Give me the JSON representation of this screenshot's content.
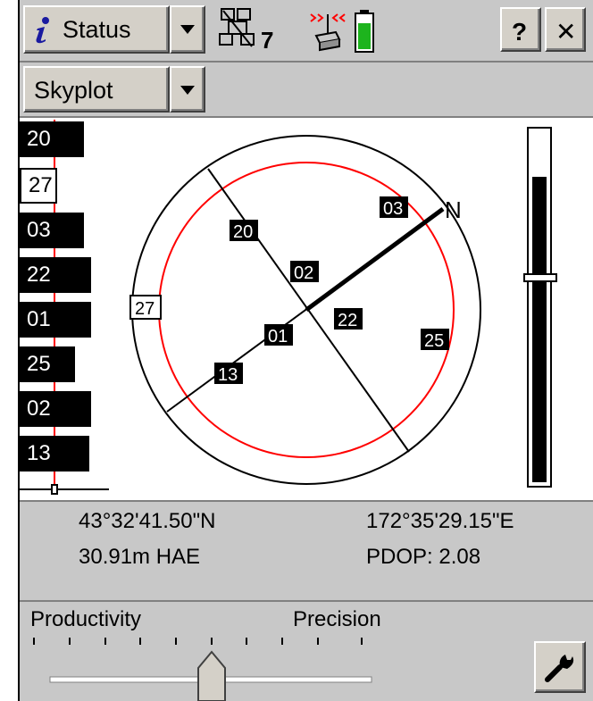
{
  "titlebar": {
    "status_label": "Status",
    "satellite_count": "7",
    "help_label": "?",
    "close_label": "✕"
  },
  "view_select": {
    "value": "Skyplot"
  },
  "satellite_bars": [
    {
      "id": "20",
      "style": "dark",
      "level": 0.37
    },
    {
      "id": "27",
      "style": "light",
      "level": 0.22
    },
    {
      "id": "03",
      "style": "dark",
      "level": 0.37
    },
    {
      "id": "22",
      "style": "dark",
      "level": 0.51
    },
    {
      "id": "01",
      "style": "dark",
      "level": 0.51
    },
    {
      "id": "25",
      "style": "dark",
      "level": 0.34
    },
    {
      "id": "02",
      "style": "dark",
      "level": 0.49
    },
    {
      "id": "13",
      "style": "dark",
      "level": 0.49
    }
  ],
  "skyplot": {
    "north_label": "N",
    "satellites": [
      {
        "id": "03",
        "style": "dark"
      },
      {
        "id": "20",
        "style": "dark"
      },
      {
        "id": "02",
        "style": "dark"
      },
      {
        "id": "27",
        "style": "light"
      },
      {
        "id": "22",
        "style": "dark"
      },
      {
        "id": "01",
        "style": "dark"
      },
      {
        "id": "25",
        "style": "dark"
      },
      {
        "id": "13",
        "style": "dark"
      }
    ]
  },
  "elevation_mask": {
    "level": 0.58
  },
  "position": {
    "latitude": "43°32'41.50\"N",
    "longitude": "172°35'29.15\"E",
    "height": "30.91m HAE",
    "pdop": "PDOP: 2.08"
  },
  "slider": {
    "left_label": "Productivity",
    "right_label": "Precision",
    "value": 0.5
  },
  "colors": {
    "mask_circle": "#ff0000",
    "battery": "#1db41d"
  }
}
